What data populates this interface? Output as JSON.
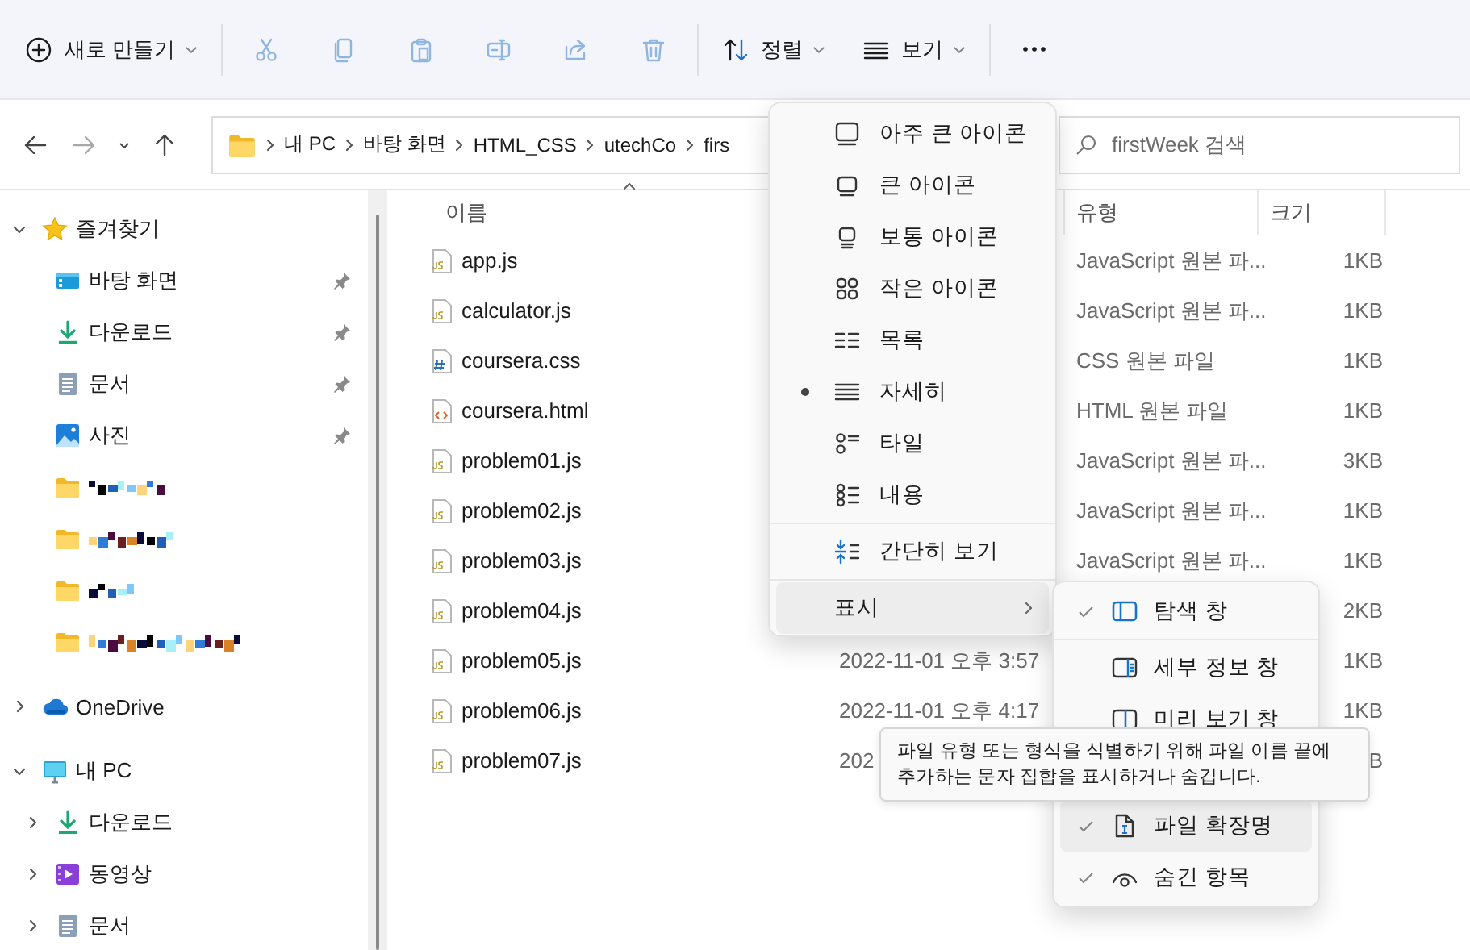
{
  "toolbar": {
    "groups": [
      [
        {
          "kind": "new",
          "label": "새로 만들기",
          "dropdown": true,
          "disabled": false
        }
      ],
      [
        {
          "kind": "cut",
          "disabled": true
        },
        {
          "kind": "copy",
          "disabled": true
        },
        {
          "kind": "paste",
          "disabled": true
        },
        {
          "kind": "rename",
          "disabled": true
        },
        {
          "kind": "share",
          "disabled": true
        },
        {
          "kind": "delete",
          "disabled": true
        }
      ],
      [
        {
          "kind": "sort",
          "label": "정렬",
          "dropdown": true,
          "disabled": false
        },
        {
          "kind": "view",
          "label": "보기",
          "dropdown": true,
          "disabled": false
        }
      ],
      [
        {
          "kind": "more",
          "disabled": false
        }
      ]
    ]
  },
  "address_bar": {
    "nav": [
      {
        "kind": "back",
        "disabled": false
      },
      {
        "kind": "forward",
        "disabled": true
      },
      {
        "kind": "recent",
        "disabled": false
      },
      {
        "kind": "up",
        "disabled": false
      }
    ],
    "breadcrumb": [
      "내 PC",
      "바탕 화면",
      "HTML_CSS",
      "utechCo",
      "firs"
    ],
    "search": {
      "placeholder": "firstWeek 검색"
    }
  },
  "sidebar": {
    "items": [
      {
        "kind": "star",
        "label": "즐겨찾기",
        "expanded": true,
        "children": [
          {
            "kind": "desktop",
            "label": "바탕 화면",
            "pinned": true
          },
          {
            "kind": "download",
            "label": "다운로드",
            "pinned": true
          },
          {
            "kind": "document",
            "label": "문서",
            "pinned": true
          },
          {
            "kind": "pictures",
            "label": "사진",
            "pinned": true
          },
          {
            "kind": "redacted",
            "pinned": false
          },
          {
            "kind": "redacted",
            "pinned": false
          },
          {
            "kind": "redacted",
            "pinned": false
          },
          {
            "kind": "redacted",
            "pinned": false
          }
        ]
      },
      {
        "kind": "cloud",
        "label": "OneDrive",
        "expanded": false
      },
      {
        "kind": "pc",
        "label": "내 PC",
        "expanded": true,
        "children": [
          {
            "kind": "download",
            "label": "다운로드",
            "expanded": false
          },
          {
            "kind": "video",
            "label": "동영상",
            "expanded": false
          },
          {
            "kind": "document",
            "label": "문서",
            "expanded": false
          }
        ]
      }
    ]
  },
  "file_list": {
    "columns": [
      {
        "kind": "name",
        "label": "이름",
        "sorted": true
      },
      {
        "kind": "type",
        "label": "유형",
        "sorted": false
      },
      {
        "kind": "size",
        "label": "크기",
        "sorted": false
      }
    ],
    "rows": [
      {
        "kind": "js",
        "name": "app.js",
        "type": "JavaScript 원본 파...",
        "size": "1KB"
      },
      {
        "kind": "js",
        "name": "calculator.js",
        "type": "JavaScript 원본 파...",
        "size": "1KB"
      },
      {
        "kind": "css",
        "name": "coursera.css",
        "type": "CSS 원본 파일",
        "size": "1KB"
      },
      {
        "kind": "html",
        "name": "coursera.html",
        "type": "HTML 원본 파일",
        "size": "1KB"
      },
      {
        "kind": "js",
        "name": "problem01.js",
        "type": "JavaScript 원본 파...",
        "size": "3KB"
      },
      {
        "kind": "js",
        "name": "problem02.js",
        "type": "JavaScript 원본 파...",
        "size": "1KB"
      },
      {
        "kind": "js",
        "name": "problem03.js",
        "type": "JavaScript 원본 파...",
        "size": "1KB"
      },
      {
        "kind": "js",
        "name": "problem04.js",
        "size": "2KB"
      },
      {
        "kind": "js",
        "name": "problem05.js",
        "date": "2022-11-01 오후 3:57",
        "size": "1KB"
      },
      {
        "kind": "js",
        "name": "problem06.js",
        "date": "2022-11-01 오후 4:17",
        "size": "1KB"
      },
      {
        "kind": "js",
        "name": "problem07.js",
        "date": "202",
        "size": "B"
      }
    ]
  },
  "view_menu": {
    "items": [
      {
        "kind": "xl-icons",
        "label": "아주 큰 아이콘",
        "selected": false
      },
      {
        "kind": "l-icons",
        "label": "큰 아이콘",
        "selected": false
      },
      {
        "kind": "m-icons",
        "label": "보통 아이콘",
        "selected": false
      },
      {
        "kind": "s-icons",
        "label": "작은 아이콘",
        "selected": false
      },
      {
        "kind": "list",
        "label": "목록",
        "selected": false
      },
      {
        "kind": "details",
        "label": "자세히",
        "selected": true
      },
      {
        "kind": "tiles",
        "label": "타일",
        "selected": false
      },
      {
        "kind": "content",
        "label": "내용",
        "selected": false
      },
      {
        "kind": "compact",
        "label": "간단히 보기",
        "checked": false
      },
      {
        "kind": "submenu",
        "label": "표시",
        "hovered": true
      }
    ]
  },
  "show_submenu": {
    "items": [
      {
        "kind": "nav-pane",
        "label": "탐색 창",
        "checked": true,
        "hovered": false
      },
      {
        "kind": "details-pane",
        "label": "세부 정보 창",
        "checked": false,
        "hovered": false
      },
      {
        "kind": "preview-pane",
        "label": "미리 보기 창",
        "checked": false,
        "hovered": false
      },
      {
        "kind": "extensions",
        "label": "파일 확장명",
        "checked": true,
        "hovered": true
      },
      {
        "kind": "hidden",
        "label": "숨긴 항목",
        "checked": true,
        "hovered": false
      }
    ]
  },
  "tooltip": {
    "text": "파일 유형 또는 형식을 식별하기 위해 파일 이름 끝에 추가하는 문자 집합을 표시하거나 숨깁니다."
  }
}
